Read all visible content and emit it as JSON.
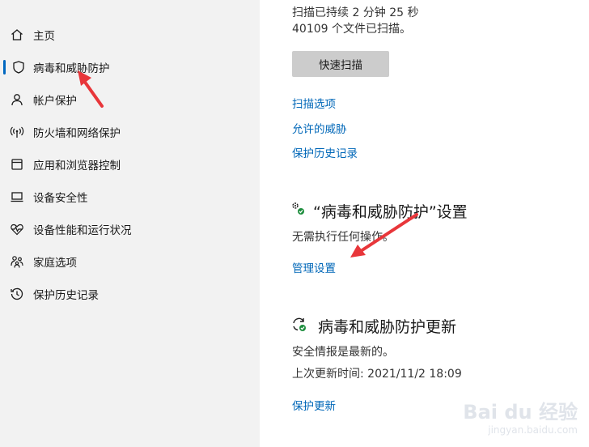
{
  "sidebar": {
    "items": [
      {
        "label": "主页",
        "icon": "home-icon"
      },
      {
        "label": "病毒和威胁防护",
        "icon": "shield-icon",
        "active": true
      },
      {
        "label": "帐户保护",
        "icon": "person-icon"
      },
      {
        "label": "防火墙和网络保护",
        "icon": "wifi-antenna-icon"
      },
      {
        "label": "应用和浏览器控制",
        "icon": "app-window-icon"
      },
      {
        "label": "设备安全性",
        "icon": "laptop-icon"
      },
      {
        "label": "设备性能和运行状况",
        "icon": "heart-pulse-icon"
      },
      {
        "label": "家庭选项",
        "icon": "family-icon"
      },
      {
        "label": "保护历史记录",
        "icon": "history-icon"
      }
    ]
  },
  "scan": {
    "duration_text": "扫描已持续 2 分钟 25 秒",
    "files_text": "40109 个文件已扫描。",
    "quick_scan_label": "快速扫描",
    "links": [
      "扫描选项",
      "允许的威胁",
      "保护历史记录"
    ]
  },
  "settings_section": {
    "title": "“病毒和威胁防护”设置",
    "status": "无需执行任何操作。",
    "link": "管理设置",
    "icon": "gears-check-icon"
  },
  "updates_section": {
    "title": "病毒和威胁防护更新",
    "status": "安全情报是最新的。",
    "last_update": "上次更新时间: 2021/11/2 18:09",
    "link": "保护更新",
    "icon": "refresh-check-icon"
  },
  "watermark": {
    "brand": "Bai du 经验",
    "url": "jingyan.baidu.com"
  },
  "colors": {
    "accent": "#0067c0",
    "link": "#0067b8",
    "annotation_arrow": "#e8363a",
    "status_ok": "#1e8e3e"
  }
}
